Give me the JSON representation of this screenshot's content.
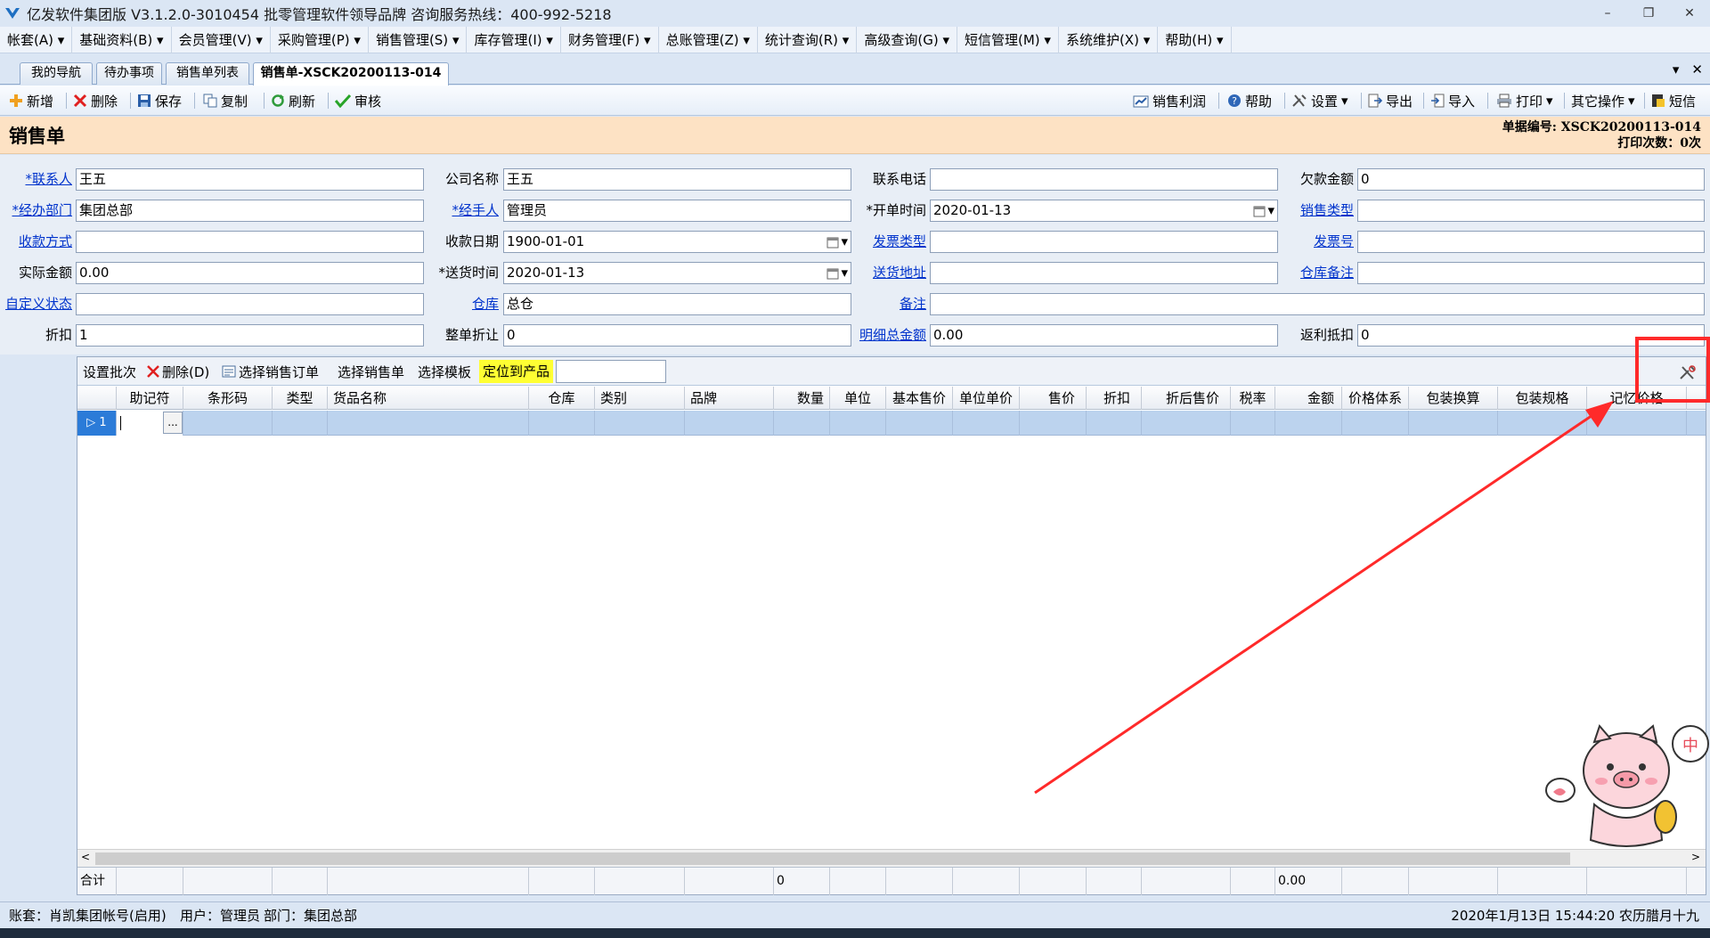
{
  "window": {
    "title": "亿发软件集团版 V3.1.2.0-3010454 批零管理软件领导品牌 咨询服务热线：400-992-5218"
  },
  "menu": [
    "帐套(A)",
    "基础资料(B)",
    "会员管理(V)",
    "采购管理(P)",
    "销售管理(S)",
    "库存管理(I)",
    "财务管理(F)",
    "总账管理(Z)",
    "统计查询(R)",
    "高级查询(G)",
    "短信管理(M)",
    "系统维护(X)",
    "帮助(H)"
  ],
  "tabs": [
    "我的导航",
    "待办事项",
    "销售单列表",
    "销售单-XSCK20200113-014"
  ],
  "toolbar": {
    "add": "新增",
    "delete": "删除",
    "save": "保存",
    "copy": "复制",
    "refresh": "刷新",
    "audit": "审核",
    "profit": "销售利润",
    "help": "帮助",
    "settings": "设置",
    "export": "导出",
    "import": "导入",
    "print": "打印",
    "other": "其它操作",
    "sms": "短信"
  },
  "form": {
    "title": "销售单",
    "doc_no_label": "单据编号:",
    "doc_no": "XSCK20200113-014",
    "print_count_label": "打印次数：",
    "print_count": "0次",
    "fields": {
      "contact": {
        "label": "*联系人",
        "value": "王五"
      },
      "company": {
        "label": "公司名称",
        "value": "王五"
      },
      "phone": {
        "label": "联系电话",
        "value": ""
      },
      "arrears": {
        "label": "欠款金额",
        "value": "0"
      },
      "dept": {
        "label": "*经办部门",
        "value": "集团总部"
      },
      "handler": {
        "label": "*经手人",
        "value": "管理员"
      },
      "open_time": {
        "label": "*开单时间",
        "value": "2020-01-13"
      },
      "sale_type": {
        "label": "销售类型",
        "value": ""
      },
      "pay_method": {
        "label": "收款方式",
        "value": ""
      },
      "pay_date": {
        "label": "收款日期",
        "value": "1900-01-01"
      },
      "invoice_type": {
        "label": "发票类型",
        "value": ""
      },
      "invoice_no": {
        "label": "发票号",
        "value": ""
      },
      "actual_amount": {
        "label": "实际金额",
        "value": "0.00"
      },
      "delivery_time": {
        "label": "*送货时间",
        "value": "2020-01-13"
      },
      "delivery_addr": {
        "label": "送货地址",
        "value": ""
      },
      "warehouse_note": {
        "label": "仓库备注",
        "value": ""
      },
      "custom_status": {
        "label": "自定义状态",
        "value": ""
      },
      "warehouse": {
        "label": "仓库",
        "value": "总仓"
      },
      "remark": {
        "label": "备注",
        "value": ""
      },
      "discount": {
        "label": "折扣",
        "value": "1"
      },
      "whole_discount": {
        "label": "整单折让",
        "value": "0"
      },
      "detail_total": {
        "label": "明细总金额",
        "value": "0.00"
      },
      "rebate": {
        "label": "返利抵扣",
        "value": "0"
      }
    }
  },
  "grid": {
    "toolbar": {
      "batch": "设置批次",
      "delete": "删除(D)",
      "select_order": "选择销售订单",
      "select_sale": "选择销售单",
      "select_template": "选择模板",
      "locate": "定位到产品"
    },
    "columns": [
      "助记符",
      "条形码",
      "类型",
      "货品名称",
      "仓库",
      "类别",
      "品牌",
      "数量",
      "单位",
      "基本售价",
      "单位单价",
      "售价",
      "折扣",
      "折后售价",
      "税率",
      "金额",
      "价格体系",
      "包装换算",
      "包装规格",
      "记忆价格"
    ],
    "row_no": "1",
    "cell_btn": "...",
    "sum_label": "合计",
    "sum_qty": "0",
    "sum_amount": "0.00"
  },
  "status": {
    "account": "账套：肖凯集团帐号(启用)",
    "user": "用户：管理员",
    "dept": "部门：集团总部",
    "datetime": "2020年1月13日 15:44:20 农历腊月十九"
  },
  "colors": {
    "highlight": "#ff2a2a",
    "accent_header": "#fde2c4",
    "selected_row": "#bcd3ee",
    "locate": "#ffff33"
  }
}
